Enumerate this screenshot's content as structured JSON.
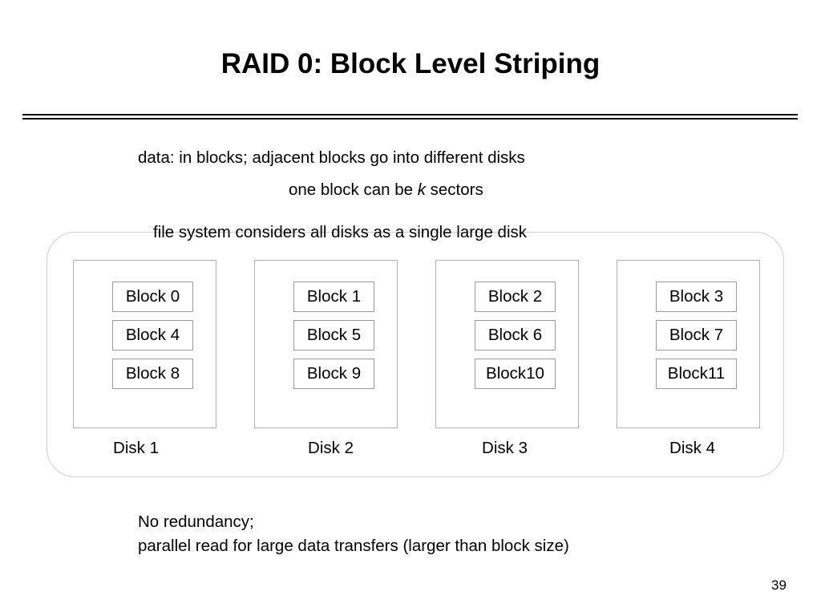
{
  "slide": {
    "title": "RAID 0: Block Level Striping",
    "page_number": "39",
    "notes": {
      "data_line": "data: in blocks; adjacent  blocks go into different disks",
      "one_block_prefix": "one block can be ",
      "one_block_var": "k",
      "one_block_suffix": " sectors",
      "file_system_line": "file system considers all disks as a single large disk"
    },
    "footer": {
      "line1": "No redundancy;",
      "line2": "parallel read for large data transfers (larger than block size)"
    }
  },
  "diagram": {
    "disks": [
      {
        "label": "Disk 1",
        "blocks": [
          "Block 0",
          "Block 4",
          "Block 8"
        ]
      },
      {
        "label": "Disk 2",
        "blocks": [
          "Block 1",
          "Block 5",
          "Block 9"
        ]
      },
      {
        "label": "Disk 3",
        "blocks": [
          "Block 2",
          "Block 6",
          "Block10"
        ]
      },
      {
        "label": "Disk 4",
        "blocks": [
          "Block 3",
          "Block 7",
          "Block11"
        ]
      }
    ]
  },
  "colors": {
    "background": "#ffffff",
    "text": "#000000",
    "rule": "#000000",
    "array_frame_border": "#cfcfcf",
    "disk_border": "#b0b0b0",
    "block_border": "#9a9a9a",
    "block_fill": "#ffffff"
  }
}
